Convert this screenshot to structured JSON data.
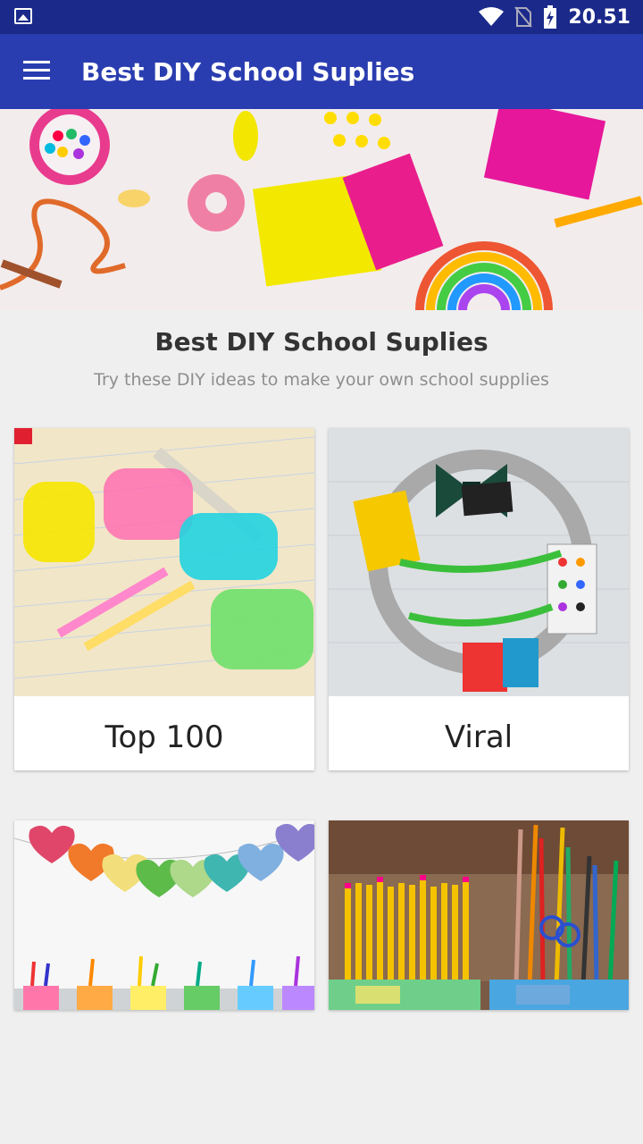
{
  "status": {
    "time": "20.51"
  },
  "appbar": {
    "title": "Best DIY School Suplies",
    "menu_icon": "hamburger-menu-icon"
  },
  "main": {
    "heading": "Best DIY School Suplies",
    "subheading": "Try these DIY ideas to make your own school supplies"
  },
  "cards": [
    {
      "label": "Top 100"
    },
    {
      "label": "Viral"
    },
    {
      "label": ""
    },
    {
      "label": ""
    }
  ],
  "colors": {
    "statusbar": "#1b2a8a",
    "appbar": "#2a3db0",
    "background": "#efefef"
  }
}
